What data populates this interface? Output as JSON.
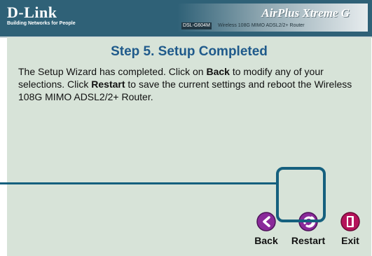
{
  "header": {
    "brand_logo": "D-Link",
    "brand_tagline": "Building Networks for People",
    "product_logo": "AirPlus Xtreme G",
    "model_badge": "DSL-G604M",
    "model_desc": "Wireless 108G MIMO ADSL2/2+ Router"
  },
  "main": {
    "title": "Step 5. Setup Completed",
    "text_1": "The Setup Wizard has completed. Click on ",
    "back_emph": "Back",
    "text_2": " to modify any of your selections. Click ",
    "restart_emph": "Restart",
    "text_3": " to save the current settings and reboot the Wireless 108G MIMO ADSL2/2+ Router."
  },
  "nav": {
    "back_label": "Back",
    "restart_label": "Restart",
    "exit_label": "Exit",
    "back_icon": "back-arrow-icon",
    "restart_icon": "restart-icon",
    "exit_icon": "exit-door-icon"
  },
  "colors": {
    "banner": "#2f6177",
    "panel": "#d7e3d8",
    "title": "#1f5a8b",
    "button_purple": "#8a2a9a",
    "exit_red": "#b5125a",
    "callout": "#15607e"
  }
}
